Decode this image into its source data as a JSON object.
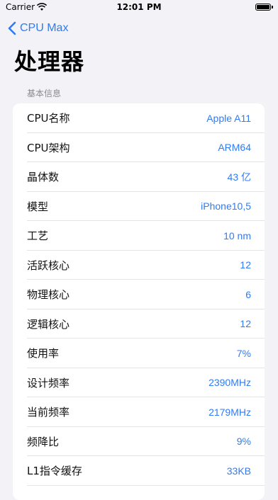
{
  "status_bar": {
    "carrier": "Carrier",
    "time": "12:01 PM"
  },
  "nav": {
    "back_label": "CPU Max"
  },
  "page": {
    "title": "处理器",
    "section_header": "基本信息"
  },
  "rows": [
    {
      "label": "CPU名称",
      "value": "Apple A11"
    },
    {
      "label": "CPU架构",
      "value": "ARM64"
    },
    {
      "label": "晶体数",
      "value": "43 亿"
    },
    {
      "label": "模型",
      "value": "iPhone10,5"
    },
    {
      "label": "工艺",
      "value": "10 nm"
    },
    {
      "label": "活跃核心",
      "value": "12"
    },
    {
      "label": "物理核心",
      "value": "6"
    },
    {
      "label": "逻辑核心",
      "value": "12"
    },
    {
      "label": "使用率",
      "value": "7%"
    },
    {
      "label": "设计频率",
      "value": "2390MHz"
    },
    {
      "label": "当前频率",
      "value": "2179MHz"
    },
    {
      "label": "频降比",
      "value": "9%"
    },
    {
      "label": "L1指令缓存",
      "value": "33KB"
    }
  ],
  "colors": {
    "accent": "#2f7bf5",
    "background": "#f2f2f7",
    "card": "#ffffff"
  },
  "icons": {
    "wifi": "wifi-icon",
    "battery": "battery-icon",
    "back": "chevron-left-icon"
  }
}
